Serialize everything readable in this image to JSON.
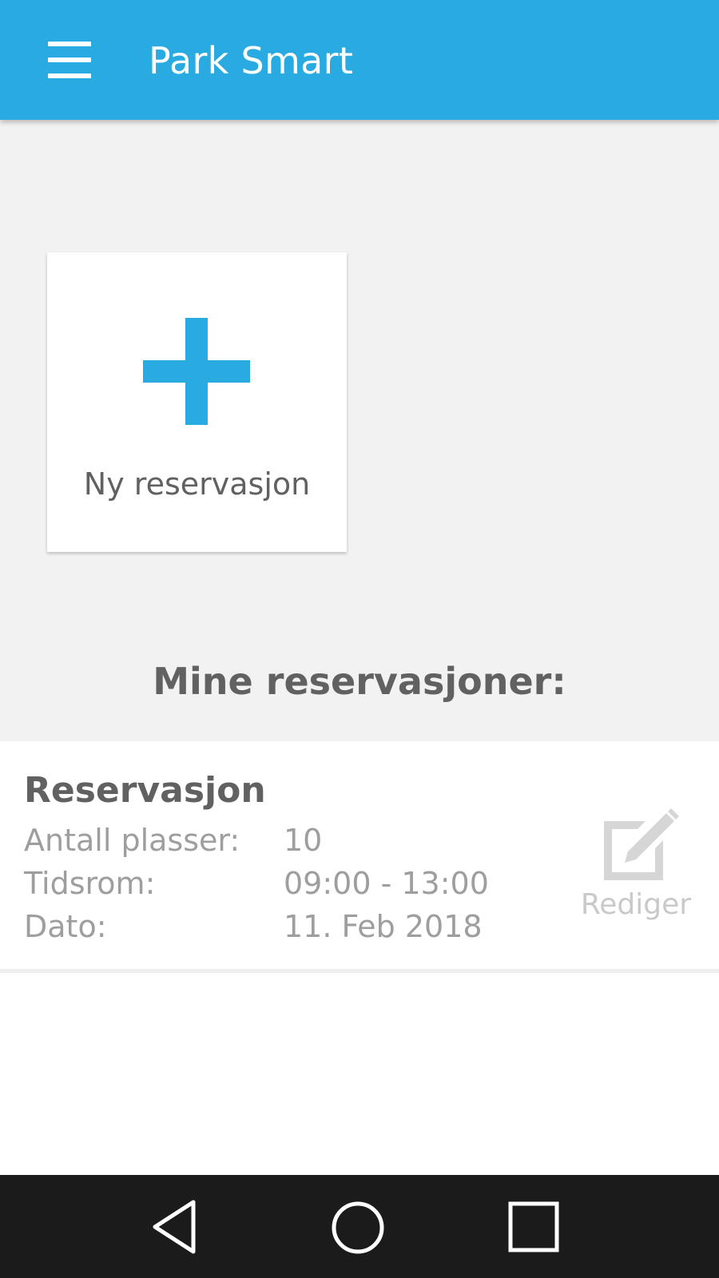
{
  "appbar": {
    "title": "Park Smart",
    "menu_icon": "hamburger-menu-icon",
    "color": "#29abe2"
  },
  "new_reservation": {
    "label": "Ny reservasjon",
    "icon": "plus-icon"
  },
  "reservations_section": {
    "title": "Mine reservasjoner:"
  },
  "reservations": [
    {
      "title": "Reservasjon",
      "rows": [
        {
          "label": "Antall plasser:",
          "value": "10"
        },
        {
          "label": "Tidsrom:",
          "value": "09:00 - 13:00"
        },
        {
          "label": "Dato:",
          "value": "11. Feb 2018"
        }
      ],
      "edit_label": "Rediger",
      "edit_icon": "edit-icon"
    }
  ],
  "navbar": {
    "back_icon": "back-triangle-icon",
    "home_icon": "home-circle-icon",
    "recent_icon": "recent-apps-square-icon"
  }
}
